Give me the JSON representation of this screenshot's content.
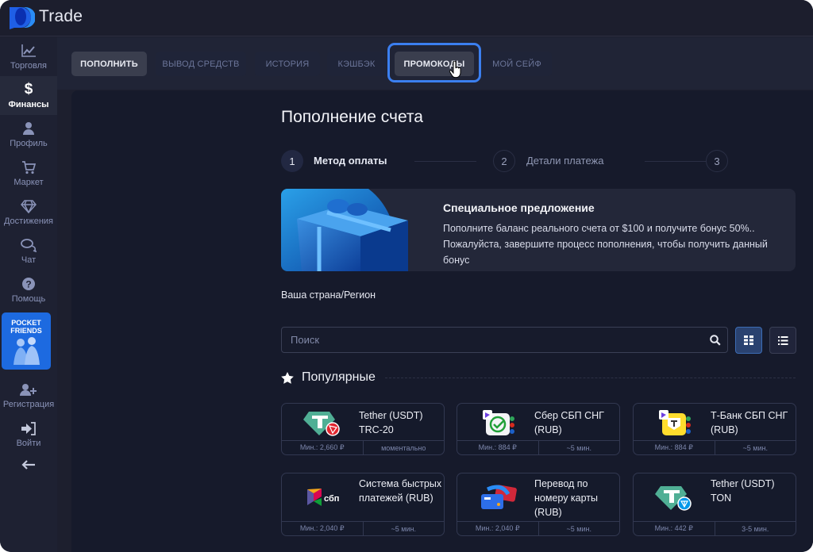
{
  "app": {
    "logo_text": "Trade"
  },
  "sidebar": {
    "items": [
      {
        "label": "Торговля",
        "icon": "chart-line-icon",
        "active": false
      },
      {
        "label": "Финансы",
        "icon": "dollar-icon",
        "active": true
      },
      {
        "label": "Профиль",
        "icon": "user-icon",
        "active": false
      },
      {
        "label": "Маркет",
        "icon": "cart-icon",
        "active": false
      },
      {
        "label": "Достижения",
        "icon": "diamond-icon",
        "active": false
      },
      {
        "label": "Чат",
        "icon": "chat-icon",
        "active": false
      },
      {
        "label": "Помощь",
        "icon": "help-icon",
        "active": false
      }
    ],
    "promo_banner": {
      "line1": "POCKET",
      "line2": "FRIENDS"
    },
    "bottom_items": [
      {
        "label": "Регистрация",
        "icon": "user-plus-icon"
      },
      {
        "label": "Войти",
        "icon": "sign-in-icon"
      }
    ],
    "collapse_icon": "arrow-left-icon"
  },
  "tabs": [
    {
      "label": "Пополнить",
      "state": "active"
    },
    {
      "label": "Вывод средств",
      "state": "normal"
    },
    {
      "label": "История",
      "state": "normal"
    },
    {
      "label": "Кэшбэк",
      "state": "normal"
    },
    {
      "label": "Промокоды",
      "state": "hover"
    },
    {
      "label": "Мой сейф",
      "state": "normal"
    }
  ],
  "page": {
    "title": "Пополнение счета",
    "steps": [
      {
        "number": "1",
        "label": "Метод оплаты",
        "active": true
      },
      {
        "number": "2",
        "label": "Детали платежа",
        "active": false
      },
      {
        "number": "3",
        "label": "",
        "active": false
      }
    ],
    "promo": {
      "title": "Специальное предложение",
      "text": "Пополните баланс реального счета от $100 и получите бонус 50%.. Пожалуйста, завершите процесс пополнения, чтобы получить данный бонус"
    },
    "region_label": "Ваша страна/Регион",
    "search": {
      "placeholder": "Поиск",
      "value": ""
    },
    "section_title": "Популярные",
    "payment_methods": [
      {
        "name": "Tether (USDT) TRC-20",
        "min": "Мин.: 2,660 ₽",
        "time": "моментально",
        "icon": "tether-trc20-icon"
      },
      {
        "name": "Сбер СБП СНГ (RUB)",
        "min": "Мин.: 884 ₽",
        "time": "~5 мин.",
        "icon": "sber-sbp-icon"
      },
      {
        "name": "Т-Банк СБП СНГ (RUB)",
        "min": "Мин.: 884 ₽",
        "time": "~5 мин.",
        "icon": "tbank-sbp-icon"
      },
      {
        "name": "Система быстрых платежей (RUB)",
        "min": "Мин.: 2,040 ₽",
        "time": "~5 мин.",
        "icon": "sbp-icon"
      },
      {
        "name": "Перевод по номеру карты (RUB)",
        "min": "Мин.: 2,040 ₽",
        "time": "~5 мин.",
        "icon": "card-transfer-icon"
      },
      {
        "name": "Tether (USDT) TON",
        "min": "Мин.: 442 ₽",
        "time": "3-5 мин.",
        "icon": "tether-ton-icon"
      }
    ]
  },
  "colors": {
    "accent": "#3b7ff0",
    "background": "#161a2b",
    "sidebar": "#1e2132",
    "tether": "#50af95"
  }
}
